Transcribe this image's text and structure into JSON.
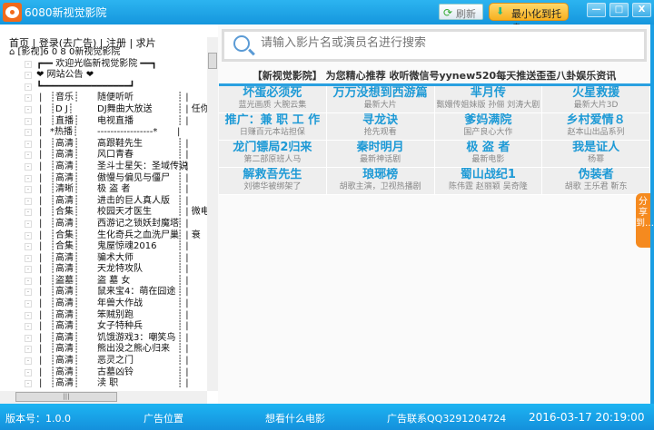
{
  "window": {
    "title": "6080新视觉影院",
    "refresh": "刷新",
    "tray": "最小化到托盘",
    "min": "—",
    "max": "□",
    "close": "X"
  },
  "nav": {
    "text": "首页 | 登录(去广告) | 注册 | 求片"
  },
  "tree": {
    "root": "[影视]6 0 8 0新视觉影院",
    "rows": [
      {
        "cat": "",
        "name": "┏━━ 欢迎光临新视觉影院 ━━┓",
        "extra": ""
      },
      {
        "cat": "",
        "name": "❤        网站公告        ❤",
        "extra": ""
      },
      {
        "cat": "",
        "name": "┗━━━━━━━━━━━━━━━━┛",
        "extra": ""
      },
      {
        "cat": "┊音乐┊",
        "name": "随便听听",
        "extra": "┊ |"
      },
      {
        "cat": "┊D J┊",
        "name": "DJ舞曲大放送",
        "extra": "┊ | 任你选"
      },
      {
        "cat": "┊直播┊",
        "name": "电视直播",
        "extra": "┊ |"
      },
      {
        "cat": "*热播┊",
        "name": "-----------------*",
        "extra": "|"
      },
      {
        "cat": "┊高清┊",
        "name": "高跟鞋先生",
        "extra": "┊ |"
      },
      {
        "cat": "┊高清┊",
        "name": "风口青春",
        "extra": "┊ |"
      },
      {
        "cat": "┊高清┊",
        "name": "圣斗士星矢：圣域传说",
        "extra": "┊ |"
      },
      {
        "cat": "┊高清┊",
        "name": "傲慢与偏见与僵尸",
        "extra": "┊ |"
      },
      {
        "cat": "┊清晰┊",
        "name": "极 盗 者",
        "extra": "┊ |"
      },
      {
        "cat": "┊高清┊",
        "name": "进击的巨人真人版",
        "extra": "┊ |"
      },
      {
        "cat": "┊合集┊",
        "name": "校园天才医生",
        "extra": "┊ | 微电影"
      },
      {
        "cat": "┊高清┊",
        "name": "西游记之锁妖封魔塔",
        "extra": "┊ |"
      },
      {
        "cat": "┊合集┊",
        "name": "生化奇兵之血洗尸巢",
        "extra": "┊ | 衰"
      },
      {
        "cat": "┊合集┊",
        "name": "鬼屋惊魂2016",
        "extra": "┊ |"
      },
      {
        "cat": "┊高清┊",
        "name": "骗术大师",
        "extra": "┊ |"
      },
      {
        "cat": "┊高清┊",
        "name": "天龙特攻队",
        "extra": "┊ |"
      },
      {
        "cat": "┊盗墓┊",
        "name": "盗 墓 女",
        "extra": "┊ |"
      },
      {
        "cat": "┊高清┊",
        "name": "鼠来宝4：萌在囧途",
        "extra": "┊ |"
      },
      {
        "cat": "┊高清┊",
        "name": "年兽大作战",
        "extra": "┊ |"
      },
      {
        "cat": "┊高清┊",
        "name": "笨贼别跑",
        "extra": "┊ |"
      },
      {
        "cat": "┊高清┊",
        "name": "女子特种兵",
        "extra": "┊ |"
      },
      {
        "cat": "┊高清┊",
        "name": "饥饿游戏3：嘲笑鸟",
        "extra": "┊ |"
      },
      {
        "cat": "┊高清┊",
        "name": "熊出没之熊心归来",
        "extra": "┊ |"
      },
      {
        "cat": "┊高清┊",
        "name": "恶灵之门",
        "extra": "┊ |"
      },
      {
        "cat": "┊高清┊",
        "name": "古墓凶铃",
        "extra": "┊ |"
      },
      {
        "cat": "┊高清┊",
        "name": "渎    职",
        "extra": "┊ |"
      }
    ]
  },
  "search": {
    "placeholder": "请输入影片名或演员名进行搜索"
  },
  "marquee": "【新视觉影院】 为您精心推荐 收听微信号yynew520每天推送歪歪八卦娱乐资讯",
  "grid": [
    {
      "t": "坏蛋必须死",
      "s": "蓝光画质 大腕云集"
    },
    {
      "t": "万万没想到西游篇",
      "s": "最新大片"
    },
    {
      "t": "芈月传",
      "s": "甄嬛传姐妹版 孙俪 刘涛大剧"
    },
    {
      "t": "火星救援",
      "s": "最新大片3D"
    },
    {
      "t": "推广：兼 职 工 作",
      "s": "日赚百元本站担保"
    },
    {
      "t": "寻龙诀",
      "s": "抢先观看"
    },
    {
      "t": "爹妈满院",
      "s": "国产良心大作"
    },
    {
      "t": "乡村爱情８",
      "s": "赵本山出品系列"
    },
    {
      "t": "龙门镖局2归来",
      "s": "第二部原班人马"
    },
    {
      "t": "秦时明月",
      "s": "最新神话剧"
    },
    {
      "t": "极 盗 者",
      "s": "最新电影"
    },
    {
      "t": "我是证人",
      "s": "杨幂"
    },
    {
      "t": "解救吾先生",
      "s": "刘德华被绑架了"
    },
    {
      "t": "琅琊榜",
      "s": "胡歌主演，卫视热播剧"
    },
    {
      "t": "蜀山战纪1",
      "s": "陈伟霆 赵丽颖 吴奇隆"
    },
    {
      "t": "伪装者",
      "s": "胡歌 王乐君 靳东"
    }
  ],
  "share": "分享到…",
  "status": {
    "version": "版本号：1.0.0",
    "ad": "广告位置",
    "want": "想看什么电影",
    "contact": "广告联系QQ3291204724",
    "datetime": "2016-03-17 20:19:00"
  },
  "colors": {
    "titlebar": "#1aa3e6",
    "accent": "#1e9ad6",
    "share": "#f58a1f"
  }
}
